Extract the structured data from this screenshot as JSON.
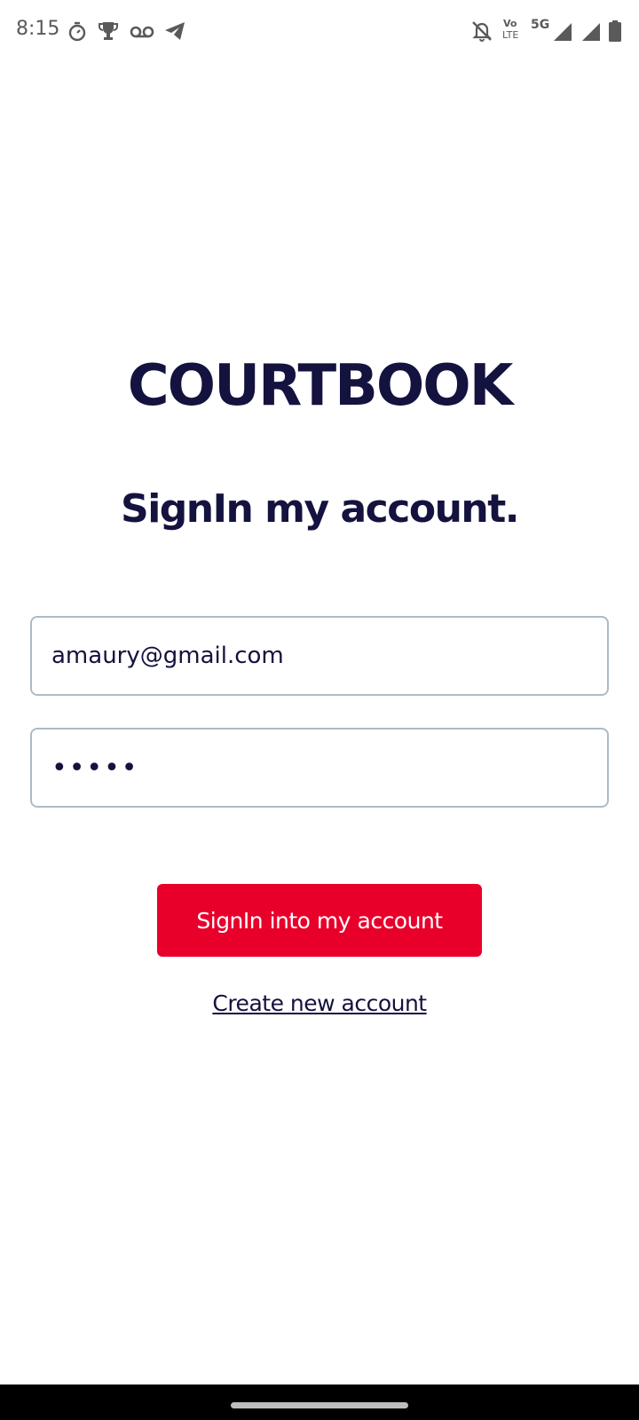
{
  "status_bar": {
    "time": "8:15",
    "icons_left": [
      "timer-icon",
      "trophy-icon",
      "voicemail-icon",
      "telegram-icon"
    ],
    "icons_right": [
      "mute-icon",
      "volte-icon",
      "5g-icon",
      "signal-icon",
      "signal-icon",
      "battery-icon"
    ],
    "volte_top": "Vo",
    "volte_bottom": "LTE",
    "network": "5G"
  },
  "app": {
    "brand": "COURTBOOK",
    "heading": "SignIn my account.",
    "email": {
      "value": "amaury@gmail.com",
      "placeholder": ""
    },
    "password": {
      "value": "•••••",
      "placeholder": ""
    },
    "signin_label": "SignIn into my account",
    "create_account_label": "Create new account"
  },
  "colors": {
    "brand_navy": "#14123f",
    "accent_red": "#e8002b",
    "field_border": "#a9bccb"
  }
}
